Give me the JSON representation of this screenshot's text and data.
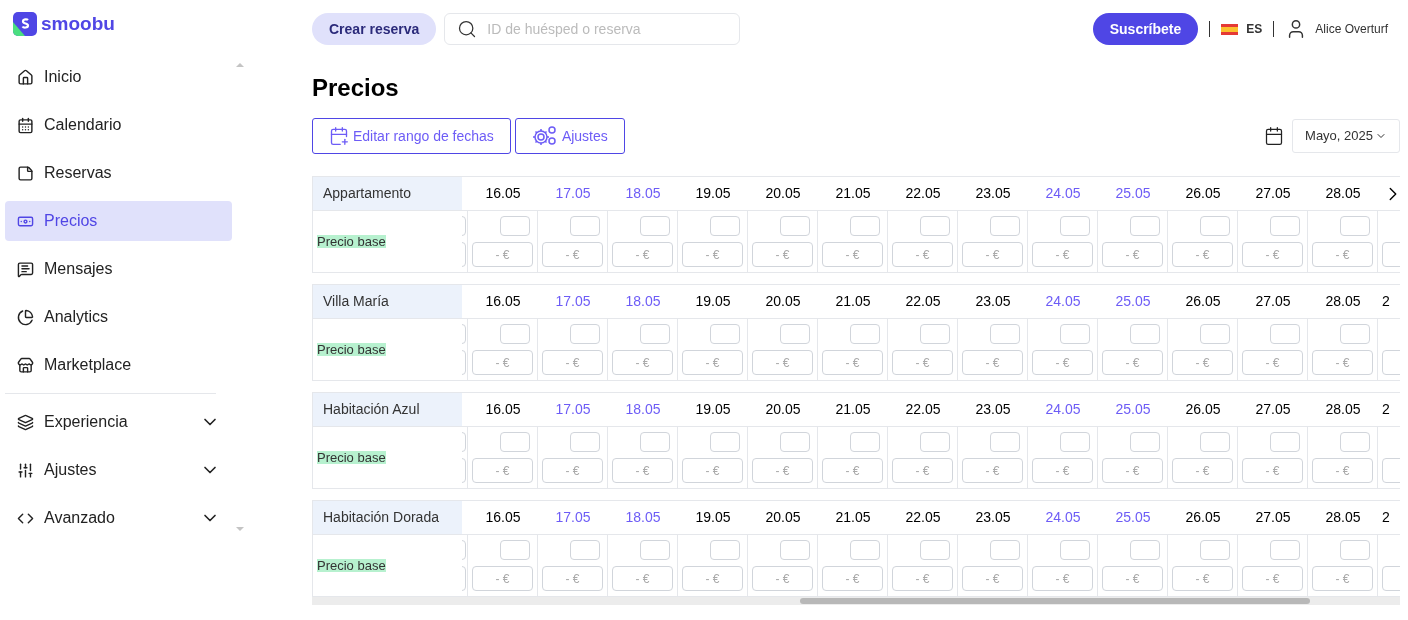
{
  "brand": "smoobu",
  "sidebar": {
    "items": [
      {
        "label": "Inicio",
        "selected": false
      },
      {
        "label": "Calendario",
        "selected": false
      },
      {
        "label": "Reservas",
        "selected": false
      },
      {
        "label": "Precios",
        "selected": true
      },
      {
        "label": "Mensajes",
        "selected": false
      },
      {
        "label": "Analytics",
        "selected": false
      },
      {
        "label": "Marketplace",
        "selected": false
      }
    ],
    "groups": [
      {
        "label": "Experiencia",
        "expanded": false
      },
      {
        "label": "Ajustes",
        "expanded": false
      },
      {
        "label": "Avanzado",
        "expanded": false
      }
    ]
  },
  "topbar": {
    "create_button": "Crear reserva",
    "search": {
      "placeholder": "ID de huésped o reserva"
    },
    "subscribe_button": "Suscríbete",
    "language": "ES",
    "user": "Alice Overturf"
  },
  "page_title": "Precios",
  "actions": [
    {
      "label": "Editar rango de fechas"
    },
    {
      "label": "Ajustes"
    }
  ],
  "month_picker": "Mayo, 2025",
  "properties": [
    {
      "name": "Appartamento",
      "row_label": "Precio base",
      "trailing": {
        "kind": "arrow"
      },
      "dates": [
        {
          "date": "16.05",
          "weekend": false,
          "placeholder": "- €"
        },
        {
          "date": "17.05",
          "weekend": true,
          "placeholder": "- €"
        },
        {
          "date": "18.05",
          "weekend": true,
          "placeholder": "- €"
        },
        {
          "date": "19.05",
          "weekend": false,
          "placeholder": "- €"
        },
        {
          "date": "20.05",
          "weekend": false,
          "placeholder": "- €"
        },
        {
          "date": "21.05",
          "weekend": false,
          "placeholder": "- €"
        },
        {
          "date": "22.05",
          "weekend": false,
          "placeholder": "- €"
        },
        {
          "date": "23.05",
          "weekend": false,
          "placeholder": "- €"
        },
        {
          "date": "24.05",
          "weekend": true,
          "placeholder": "- €"
        },
        {
          "date": "25.05",
          "weekend": true,
          "placeholder": "- €"
        },
        {
          "date": "26.05",
          "weekend": false,
          "placeholder": "- €"
        },
        {
          "date": "27.05",
          "weekend": false,
          "placeholder": "- €"
        },
        {
          "date": "28.05",
          "weekend": false,
          "placeholder": "- €"
        }
      ]
    },
    {
      "name": "Villa María",
      "row_label": "Precio base",
      "trailing": {
        "kind": "text",
        "text": "2"
      },
      "dates": [
        {
          "date": "16.05",
          "weekend": false,
          "placeholder": "- €"
        },
        {
          "date": "17.05",
          "weekend": true,
          "placeholder": "- €"
        },
        {
          "date": "18.05",
          "weekend": true,
          "placeholder": "- €"
        },
        {
          "date": "19.05",
          "weekend": false,
          "placeholder": "- €"
        },
        {
          "date": "20.05",
          "weekend": false,
          "placeholder": "- €"
        },
        {
          "date": "21.05",
          "weekend": false,
          "placeholder": "- €"
        },
        {
          "date": "22.05",
          "weekend": false,
          "placeholder": "- €"
        },
        {
          "date": "23.05",
          "weekend": false,
          "placeholder": "- €"
        },
        {
          "date": "24.05",
          "weekend": true,
          "placeholder": "- €"
        },
        {
          "date": "25.05",
          "weekend": true,
          "placeholder": "- €"
        },
        {
          "date": "26.05",
          "weekend": false,
          "placeholder": "- €"
        },
        {
          "date": "27.05",
          "weekend": false,
          "placeholder": "- €"
        },
        {
          "date": "28.05",
          "weekend": false,
          "placeholder": "- €"
        }
      ]
    },
    {
      "name": "Habitación Azul",
      "row_label": "Precio base",
      "trailing": {
        "kind": "text",
        "text": "2"
      },
      "dates": [
        {
          "date": "16.05",
          "weekend": false,
          "placeholder": "- €"
        },
        {
          "date": "17.05",
          "weekend": true,
          "placeholder": "- €"
        },
        {
          "date": "18.05",
          "weekend": true,
          "placeholder": "- €"
        },
        {
          "date": "19.05",
          "weekend": false,
          "placeholder": "- €"
        },
        {
          "date": "20.05",
          "weekend": false,
          "placeholder": "- €"
        },
        {
          "date": "21.05",
          "weekend": false,
          "placeholder": "- €"
        },
        {
          "date": "22.05",
          "weekend": false,
          "placeholder": "- €"
        },
        {
          "date": "23.05",
          "weekend": false,
          "placeholder": "- €"
        },
        {
          "date": "24.05",
          "weekend": true,
          "placeholder": "- €"
        },
        {
          "date": "25.05",
          "weekend": true,
          "placeholder": "- €"
        },
        {
          "date": "26.05",
          "weekend": false,
          "placeholder": "- €"
        },
        {
          "date": "27.05",
          "weekend": false,
          "placeholder": "- €"
        },
        {
          "date": "28.05",
          "weekend": false,
          "placeholder": "- €"
        }
      ]
    },
    {
      "name": "Habitación Dorada",
      "row_label": "Precio base",
      "trailing": {
        "kind": "text",
        "text": "2"
      },
      "dates": [
        {
          "date": "16.05",
          "weekend": false,
          "placeholder": "- €"
        },
        {
          "date": "17.05",
          "weekend": true,
          "placeholder": "- €"
        },
        {
          "date": "18.05",
          "weekend": true,
          "placeholder": "- €"
        },
        {
          "date": "19.05",
          "weekend": false,
          "placeholder": "- €"
        },
        {
          "date": "20.05",
          "weekend": false,
          "placeholder": "- €"
        },
        {
          "date": "21.05",
          "weekend": false,
          "placeholder": "- €"
        },
        {
          "date": "22.05",
          "weekend": false,
          "placeholder": "- €"
        },
        {
          "date": "23.05",
          "weekend": false,
          "placeholder": "- €"
        },
        {
          "date": "24.05",
          "weekend": true,
          "placeholder": "- €"
        },
        {
          "date": "25.05",
          "weekend": true,
          "placeholder": "- €"
        },
        {
          "date": "26.05",
          "weekend": false,
          "placeholder": "- €"
        },
        {
          "date": "27.05",
          "weekend": false,
          "placeholder": "- €"
        },
        {
          "date": "28.05",
          "weekend": false,
          "placeholder": "- €"
        }
      ]
    }
  ]
}
